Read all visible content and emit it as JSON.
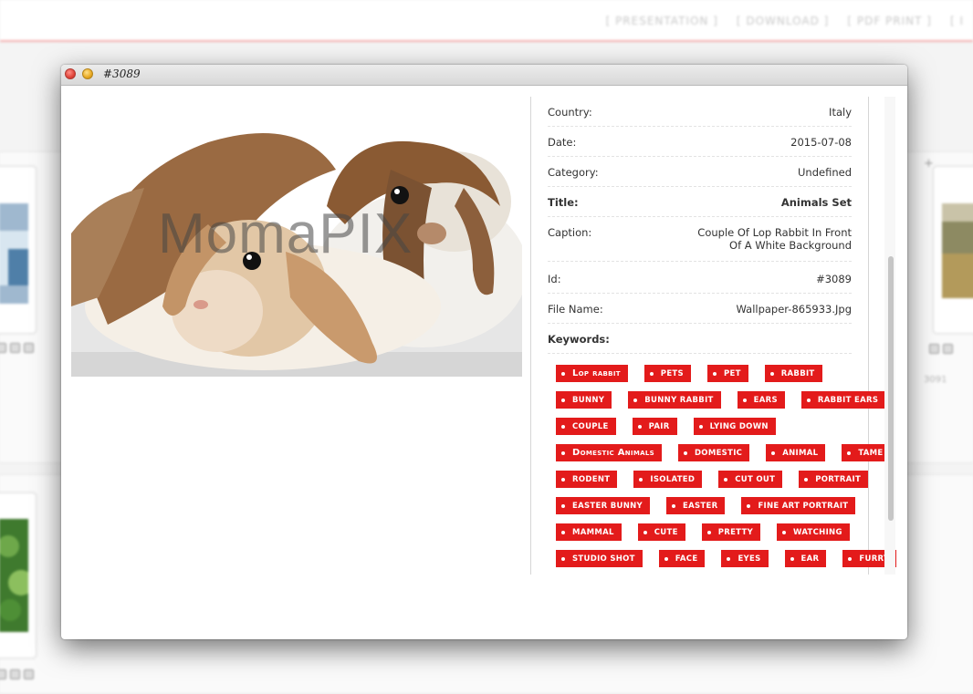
{
  "background": {
    "nav": [
      "[ PRESENTATION ]",
      "[ DOWNLOAD ]",
      "[ PDF PRINT ]",
      "[ I"
    ],
    "right_card_id": "3091"
  },
  "window": {
    "title": "#3089"
  },
  "photo": {
    "watermark": "MomaPIX",
    "alt": "Couple of lop rabbits"
  },
  "details": [
    {
      "label": "Country:",
      "value": "Italy",
      "bold": false
    },
    {
      "label": "Date:",
      "value": "2015-07-08",
      "bold": false
    },
    {
      "label": "Category:",
      "value": "Undefined",
      "bold": false
    },
    {
      "label": "Title:",
      "value": "Animals Set",
      "bold": true
    },
    {
      "label": "Caption:",
      "value": "Couple Of Lop Rabbit In Front Of A White Background",
      "bold": false
    },
    {
      "label": "Id:",
      "value": "#3089",
      "bold": false
    },
    {
      "label": "File Name:",
      "value": "Wallpaper-865933.Jpg",
      "bold": false
    }
  ],
  "keywords_label": "Keywords:",
  "keywords": [
    [
      "Lop rabbit",
      "PETS",
      "PET",
      "RABBIT"
    ],
    [
      "BUNNY",
      "BUNNY RABBIT",
      "EARS",
      "RABBIT EARS"
    ],
    [
      "COUPLE",
      "PAIR",
      "LYING DOWN"
    ],
    [
      "Domestic Animals",
      "DOMESTIC",
      "ANIMAL",
      "TAME"
    ],
    [
      "RODENT",
      "ISOLATED",
      "CUT OUT",
      "PORTRAIT"
    ],
    [
      "EASTER BUNNY",
      "EASTER",
      "FINE ART PORTRAIT"
    ],
    [
      "MAMMAL",
      "CUTE",
      "PRETTY",
      "WATCHING"
    ],
    [
      "STUDIO SHOT",
      "FACE",
      "EYES",
      "EAR",
      "FURRY"
    ]
  ],
  "colors": {
    "tag": "#e31b1b",
    "accent_line": "#f3b0b0"
  }
}
